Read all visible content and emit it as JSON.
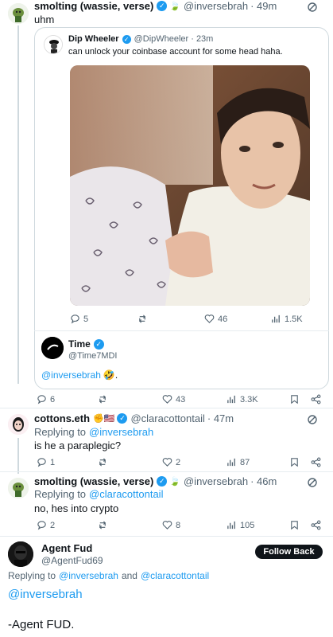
{
  "thread": {
    "post1": {
      "name": "smolting (wassie, verse)",
      "handle": "@inversebrah",
      "time": "· 49m",
      "text": "uhm",
      "quoted": {
        "name": "Dip Wheeler",
        "handle": "@DipWheeler",
        "time": "· 23m",
        "text": "can unlock your coinbase account for some head haha.",
        "retweets": "",
        "likes": "46",
        "views": "1.5K",
        "replies": "5"
      },
      "reply_preview": {
        "name": "Time",
        "handle": "@Time7MDI",
        "mention": "@inversebrah",
        "emoji": "🤣."
      },
      "replies": "6",
      "retweets": "",
      "likes": "43",
      "views": "3.3K"
    },
    "post2": {
      "name": "cottons.eth",
      "handle": "@claracottontail",
      "time": "· 47m",
      "replying_label": "Replying to",
      "replying_to": "@inversebrah",
      "text": "is he a paraplegic?",
      "replies": "1",
      "likes": "2",
      "views": "87"
    },
    "post3": {
      "name": "smolting (wassie, verse)",
      "handle": "@inversebrah",
      "time": "· 46m",
      "replying_label": "Replying to",
      "replying_to": "@claracottontail",
      "text": "no, hes into crypto",
      "replies": "2",
      "likes": "8",
      "views": "105"
    },
    "post4": {
      "name": "Agent Fud",
      "handle": "@AgentFud69",
      "follow_label": "Follow Back",
      "replying_label": "Replying to",
      "replying_to_1": "@inversebrah",
      "and": "and",
      "replying_to_2": "@claracottontail",
      "mention": "@inversebrah",
      "signoff": "-Agent FUD."
    }
  },
  "colors": {
    "link": "#1d9bf0",
    "muted": "#536471",
    "border": "#cfd9de"
  },
  "icons": [
    "reply-icon",
    "retweet-icon",
    "like-icon",
    "views-icon",
    "bookmark-icon",
    "share-icon",
    "grok-icon",
    "verified-icon"
  ]
}
